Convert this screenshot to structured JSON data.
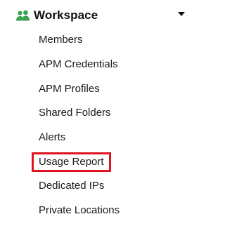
{
  "section": {
    "title": "Workspace",
    "icon": "users-icon",
    "toggle_icon": "caret-down-icon",
    "icon_color": "#3aa24a",
    "highlight_color": "#e0141e"
  },
  "menu": {
    "items": [
      {
        "label": "Members"
      },
      {
        "label": "APM Credentials"
      },
      {
        "label": "APM Profiles"
      },
      {
        "label": "Shared Folders"
      },
      {
        "label": "Alerts"
      },
      {
        "label": "Usage Report",
        "highlighted": true
      },
      {
        "label": "Dedicated IPs"
      },
      {
        "label": "Private Locations"
      }
    ]
  }
}
